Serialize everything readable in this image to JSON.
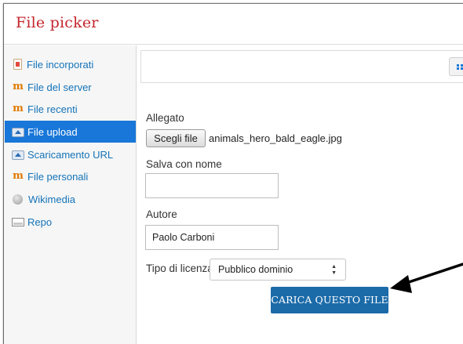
{
  "dialog": {
    "title": "File picker"
  },
  "sidebar": {
    "items": [
      {
        "label": "File incorporati",
        "icon": "document-icon",
        "active": false
      },
      {
        "label": "File del server",
        "icon": "moodle-icon",
        "active": false
      },
      {
        "label": "File recenti",
        "icon": "moodle-icon",
        "active": false
      },
      {
        "label": "File upload",
        "icon": "upload-icon",
        "active": true
      },
      {
        "label": "Scaricamento URL",
        "icon": "url-download-icon",
        "active": false
      },
      {
        "label": "File personali",
        "icon": "moodle-icon",
        "active": false
      },
      {
        "label": "Wikimedia",
        "icon": "wikimedia-icon",
        "active": false
      },
      {
        "label": "Repo",
        "icon": "repository-icon",
        "active": false
      }
    ]
  },
  "form": {
    "attachment_label": "Allegato",
    "choose_file_label": "Scegli file",
    "chosen_file": "animals_hero_bald_eagle.jpg",
    "save_as_label": "Salva con nome",
    "save_as_value": "",
    "author_label": "Autore",
    "author_value": "Paolo Carboni",
    "license_label": "Tipo di licenza",
    "license_value": "Pubblico dominio",
    "upload_button": "CARICA QUESTO FILE"
  },
  "colors": {
    "title": "#c4262e",
    "link": "#1473b8",
    "active_item": "#1877d8",
    "upload_button": "#1b6ba9"
  }
}
